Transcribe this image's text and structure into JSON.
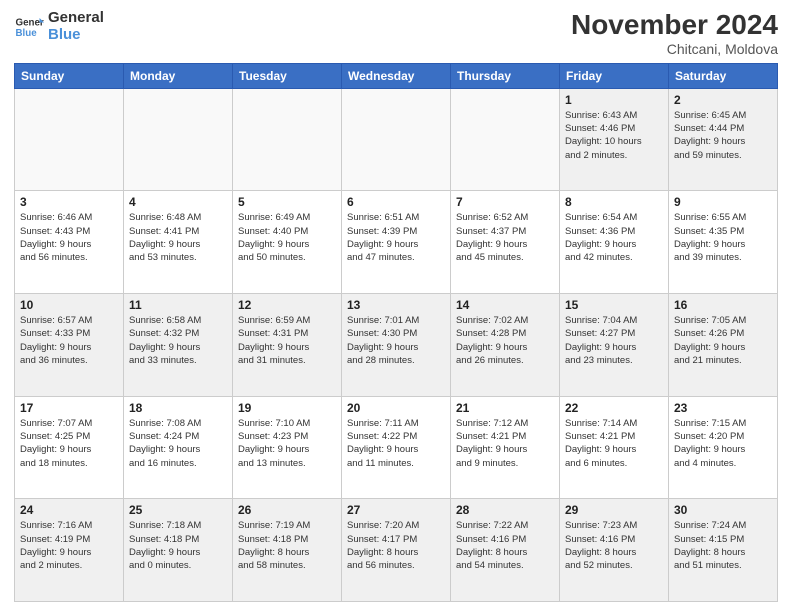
{
  "header": {
    "logo_line1": "General",
    "logo_line2": "Blue",
    "month": "November 2024",
    "location": "Chitcani, Moldova"
  },
  "weekdays": [
    "Sunday",
    "Monday",
    "Tuesday",
    "Wednesday",
    "Thursday",
    "Friday",
    "Saturday"
  ],
  "weeks": [
    [
      {
        "day": "",
        "info": ""
      },
      {
        "day": "",
        "info": ""
      },
      {
        "day": "",
        "info": ""
      },
      {
        "day": "",
        "info": ""
      },
      {
        "day": "",
        "info": ""
      },
      {
        "day": "1",
        "info": "Sunrise: 6:43 AM\nSunset: 4:46 PM\nDaylight: 10 hours\nand 2 minutes."
      },
      {
        "day": "2",
        "info": "Sunrise: 6:45 AM\nSunset: 4:44 PM\nDaylight: 9 hours\nand 59 minutes."
      }
    ],
    [
      {
        "day": "3",
        "info": "Sunrise: 6:46 AM\nSunset: 4:43 PM\nDaylight: 9 hours\nand 56 minutes."
      },
      {
        "day": "4",
        "info": "Sunrise: 6:48 AM\nSunset: 4:41 PM\nDaylight: 9 hours\nand 53 minutes."
      },
      {
        "day": "5",
        "info": "Sunrise: 6:49 AM\nSunset: 4:40 PM\nDaylight: 9 hours\nand 50 minutes."
      },
      {
        "day": "6",
        "info": "Sunrise: 6:51 AM\nSunset: 4:39 PM\nDaylight: 9 hours\nand 47 minutes."
      },
      {
        "day": "7",
        "info": "Sunrise: 6:52 AM\nSunset: 4:37 PM\nDaylight: 9 hours\nand 45 minutes."
      },
      {
        "day": "8",
        "info": "Sunrise: 6:54 AM\nSunset: 4:36 PM\nDaylight: 9 hours\nand 42 minutes."
      },
      {
        "day": "9",
        "info": "Sunrise: 6:55 AM\nSunset: 4:35 PM\nDaylight: 9 hours\nand 39 minutes."
      }
    ],
    [
      {
        "day": "10",
        "info": "Sunrise: 6:57 AM\nSunset: 4:33 PM\nDaylight: 9 hours\nand 36 minutes."
      },
      {
        "day": "11",
        "info": "Sunrise: 6:58 AM\nSunset: 4:32 PM\nDaylight: 9 hours\nand 33 minutes."
      },
      {
        "day": "12",
        "info": "Sunrise: 6:59 AM\nSunset: 4:31 PM\nDaylight: 9 hours\nand 31 minutes."
      },
      {
        "day": "13",
        "info": "Sunrise: 7:01 AM\nSunset: 4:30 PM\nDaylight: 9 hours\nand 28 minutes."
      },
      {
        "day": "14",
        "info": "Sunrise: 7:02 AM\nSunset: 4:28 PM\nDaylight: 9 hours\nand 26 minutes."
      },
      {
        "day": "15",
        "info": "Sunrise: 7:04 AM\nSunset: 4:27 PM\nDaylight: 9 hours\nand 23 minutes."
      },
      {
        "day": "16",
        "info": "Sunrise: 7:05 AM\nSunset: 4:26 PM\nDaylight: 9 hours\nand 21 minutes."
      }
    ],
    [
      {
        "day": "17",
        "info": "Sunrise: 7:07 AM\nSunset: 4:25 PM\nDaylight: 9 hours\nand 18 minutes."
      },
      {
        "day": "18",
        "info": "Sunrise: 7:08 AM\nSunset: 4:24 PM\nDaylight: 9 hours\nand 16 minutes."
      },
      {
        "day": "19",
        "info": "Sunrise: 7:10 AM\nSunset: 4:23 PM\nDaylight: 9 hours\nand 13 minutes."
      },
      {
        "day": "20",
        "info": "Sunrise: 7:11 AM\nSunset: 4:22 PM\nDaylight: 9 hours\nand 11 minutes."
      },
      {
        "day": "21",
        "info": "Sunrise: 7:12 AM\nSunset: 4:21 PM\nDaylight: 9 hours\nand 9 minutes."
      },
      {
        "day": "22",
        "info": "Sunrise: 7:14 AM\nSunset: 4:21 PM\nDaylight: 9 hours\nand 6 minutes."
      },
      {
        "day": "23",
        "info": "Sunrise: 7:15 AM\nSunset: 4:20 PM\nDaylight: 9 hours\nand 4 minutes."
      }
    ],
    [
      {
        "day": "24",
        "info": "Sunrise: 7:16 AM\nSunset: 4:19 PM\nDaylight: 9 hours\nand 2 minutes."
      },
      {
        "day": "25",
        "info": "Sunrise: 7:18 AM\nSunset: 4:18 PM\nDaylight: 9 hours\nand 0 minutes."
      },
      {
        "day": "26",
        "info": "Sunrise: 7:19 AM\nSunset: 4:18 PM\nDaylight: 8 hours\nand 58 minutes."
      },
      {
        "day": "27",
        "info": "Sunrise: 7:20 AM\nSunset: 4:17 PM\nDaylight: 8 hours\nand 56 minutes."
      },
      {
        "day": "28",
        "info": "Sunrise: 7:22 AM\nSunset: 4:16 PM\nDaylight: 8 hours\nand 54 minutes."
      },
      {
        "day": "29",
        "info": "Sunrise: 7:23 AM\nSunset: 4:16 PM\nDaylight: 8 hours\nand 52 minutes."
      },
      {
        "day": "30",
        "info": "Sunrise: 7:24 AM\nSunset: 4:15 PM\nDaylight: 8 hours\nand 51 minutes."
      }
    ]
  ]
}
